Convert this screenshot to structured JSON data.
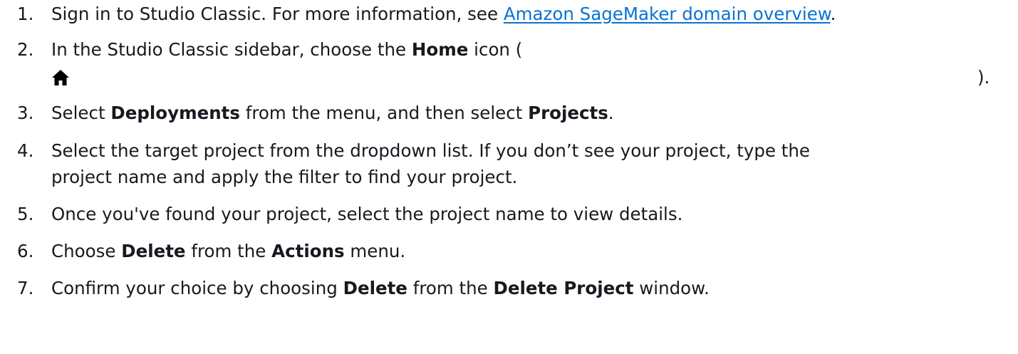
{
  "steps": [
    {
      "num": "1.",
      "text_before": "Sign in to Studio Classic. For more information, see ",
      "link": "Amazon SageMaker domain overview",
      "text_after": "."
    },
    {
      "num": "2.",
      "text_before": "In the Studio Classic sidebar, choose the ",
      "bold": "Home",
      "text_after": " icon (",
      "icon": "home-icon",
      "close": ")."
    },
    {
      "num": "3.",
      "text_before": "Select ",
      "bold1": "Deployments",
      "text_mid": " from the menu, and then select ",
      "bold2": "Projects",
      "text_after": "."
    },
    {
      "num": "4.",
      "line1": "Select the target project from the dropdown list. If you don’t see your project, type the",
      "line2": "project name and apply the filter to find your project."
    },
    {
      "num": "5.",
      "text": "Once you've found your project, select the project name to view details."
    },
    {
      "num": "6.",
      "text_before": "Choose ",
      "bold1": "Delete",
      "text_mid": " from the ",
      "bold2": "Actions",
      "text_after": " menu."
    },
    {
      "num": "7.",
      "text_before": "Confirm your choice by choosing ",
      "bold1": "Delete",
      "text_mid": " from the ",
      "bold2": "Delete Project",
      "text_after": " window."
    }
  ]
}
